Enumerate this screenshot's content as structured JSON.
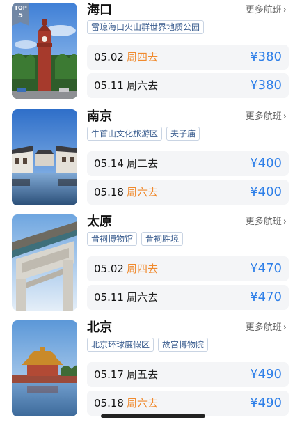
{
  "more_label": "更多航班",
  "destinations": [
    {
      "city": "海口",
      "badge": {
        "line1": "TOP",
        "line2": "5"
      },
      "tags": [
        "雷琼海口火山群世界地质公园"
      ],
      "flights": [
        {
          "date": "05.02",
          "day": "周四去",
          "day_highlight": true,
          "price": "¥380"
        },
        {
          "date": "05.11",
          "day": "周六去",
          "day_highlight": false,
          "price": "¥380"
        }
      ]
    },
    {
      "city": "南京",
      "tags": [
        "牛首山文化旅游区",
        "夫子庙"
      ],
      "flights": [
        {
          "date": "05.14",
          "day": "周二去",
          "day_highlight": false,
          "price": "¥400"
        },
        {
          "date": "05.18",
          "day": "周六去",
          "day_highlight": true,
          "price": "¥400"
        }
      ]
    },
    {
      "city": "太原",
      "tags": [
        "晋祠博物馆",
        "晋祠胜境"
      ],
      "flights": [
        {
          "date": "05.02",
          "day": "周四去",
          "day_highlight": true,
          "price": "¥470"
        },
        {
          "date": "05.11",
          "day": "周六去",
          "day_highlight": false,
          "price": "¥470"
        }
      ]
    },
    {
      "city": "北京",
      "tags": [
        "北京环球度假区",
        "故宫博物院"
      ],
      "flights": [
        {
          "date": "05.17",
          "day": "周五去",
          "day_highlight": false,
          "price": "¥490"
        },
        {
          "date": "05.18",
          "day": "周六去",
          "day_highlight": true,
          "price": "¥490"
        }
      ]
    }
  ],
  "colors": {
    "price": "#2e7fe8",
    "highlight_day": "#f08a2e",
    "tag_text": "#3a5d8f",
    "row_bg": "#f4f5f7"
  }
}
